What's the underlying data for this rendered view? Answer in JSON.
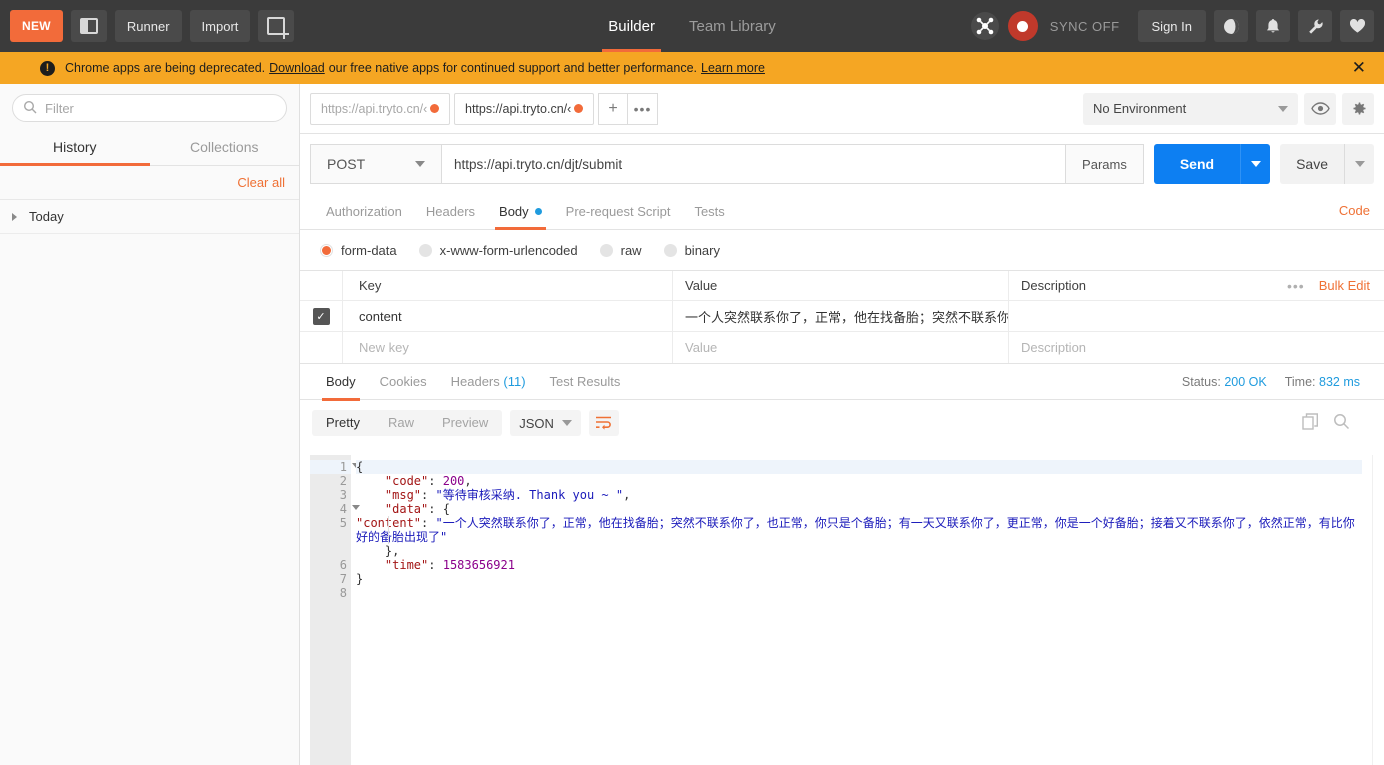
{
  "topbar": {
    "new_label": "NEW",
    "sidebar_toggle": "sidebar-toggle",
    "runner_label": "Runner",
    "import_label": "Import",
    "new_tab_label": "new-tab",
    "tabs": [
      {
        "label": "Builder",
        "active": true
      },
      {
        "label": "Team Library",
        "active": false
      }
    ],
    "sync_label": "SYNC OFF",
    "signin_label": "Sign In"
  },
  "banner": {
    "text_before": "Chrome apps are being deprecated.",
    "link1": "Download",
    "text_middle": "our free native apps for continued support and better performance.",
    "link2": "Learn more",
    "close": "✕",
    "bg_color": "#f5a623"
  },
  "sidebar": {
    "filter_placeholder": "Filter",
    "filter_value": "",
    "tabs": [
      {
        "label": "History",
        "active": true
      },
      {
        "label": "Collections",
        "active": false
      }
    ],
    "clear_all": "Clear all",
    "today_label": "Today"
  },
  "request_tabs": [
    {
      "url": "https://api.tryto.cn/‹",
      "active": false,
      "unsaved": true
    },
    {
      "url": "https://api.tryto.cn/‹",
      "active": true,
      "unsaved": true
    }
  ],
  "tabstrip": {
    "add": "+",
    "more": "•••"
  },
  "environment": {
    "selected": "No Environment",
    "eye_icon": "eye-icon",
    "gear_icon": "gear-icon"
  },
  "url_bar": {
    "method": "POST",
    "url": "https://api.tryto.cn/djt/submit",
    "params_label": "Params",
    "send_label": "Send",
    "save_label": "Save",
    "send_color": "#0d7ff2"
  },
  "request_tabs_row": {
    "tabs": [
      {
        "label": "Authorization",
        "active": false,
        "dot": false
      },
      {
        "label": "Headers",
        "active": false,
        "dot": false
      },
      {
        "label": "Body",
        "active": true,
        "dot": true
      },
      {
        "label": "Pre-request Script",
        "active": false,
        "dot": false
      },
      {
        "label": "Tests",
        "active": false,
        "dot": false
      }
    ],
    "code_link": "Code"
  },
  "body_modes": [
    {
      "label": "form-data",
      "selected": true
    },
    {
      "label": "x-www-form-urlencoded",
      "selected": false
    },
    {
      "label": "raw",
      "selected": false
    },
    {
      "label": "binary",
      "selected": false
    }
  ],
  "kv_table": {
    "headers": {
      "key": "Key",
      "value": "Value",
      "description": "Description"
    },
    "bulk_edit": "Bulk Edit",
    "more": "•••",
    "rows": [
      {
        "checked": true,
        "key": "content",
        "value": "一个人突然联系你了，正常，他在找备胎；突然不联系你了...",
        "description": ""
      }
    ],
    "empty_row": {
      "key": "New key",
      "value": "Value",
      "description": "Description"
    }
  },
  "response": {
    "tabs": [
      {
        "label": "Body",
        "active": true,
        "count": ""
      },
      {
        "label": "Cookies",
        "active": false,
        "count": ""
      },
      {
        "label": "Headers",
        "active": false,
        "count": "(11)"
      },
      {
        "label": "Test Results",
        "active": false,
        "count": ""
      }
    ],
    "status_label": "Status:",
    "status_value": "200 OK",
    "time_label": "Time:",
    "time_value": "832 ms",
    "view_modes": [
      {
        "label": "Pretty",
        "active": true
      },
      {
        "label": "Raw",
        "active": false
      },
      {
        "label": "Preview",
        "active": false
      }
    ],
    "format": "JSON",
    "wrap_icon": "word-wrap-icon",
    "copy_icon": "copy-icon",
    "search_icon": "search-icon",
    "body_lines": [
      {
        "n": 1,
        "fold": true,
        "highlight": true,
        "text": "{"
      },
      {
        "n": 2,
        "fold": false,
        "highlight": false,
        "text": "    \"code\": 200,"
      },
      {
        "n": 3,
        "fold": false,
        "highlight": false,
        "text": "    \"msg\": \"等待审核采纳. Thank you ~ \","
      },
      {
        "n": 4,
        "fold": true,
        "highlight": false,
        "text": "    \"data\": {"
      },
      {
        "n": 5,
        "fold": false,
        "highlight": false,
        "text": "        \"content\": \"一个人突然联系你了，正常，他在找备胎；突然不联系你了，也正常，你只是个备胎；有一天又联系你了，更正常，你是一个好备胎；接着又不联系你了，依然正常，有比你好的备胎出现了\""
      },
      {
        "n": 6,
        "fold": false,
        "highlight": false,
        "text": "    },"
      },
      {
        "n": 7,
        "fold": false,
        "highlight": false,
        "text": "    \"time\": 1583656921"
      },
      {
        "n": 8,
        "fold": false,
        "highlight": false,
        "text": "}"
      }
    ],
    "json": {
      "code": 200,
      "msg": "等待审核采纳. Thank you ~ ",
      "data_content": "一个人突然联系你了，正常，他在找备胎；突然不联系你了，也正常，你只是个备胎；有一天又联系你了，更正常，你是一个好备胎；接着又不联系你了，依然正常，有比你好的备胎出现了",
      "time": 1583656921
    }
  },
  "colors": {
    "accent": "#f26b3a",
    "blue": "#0d7ff2",
    "link_blue": "#1f9bde",
    "topbar": "#3b3b3b"
  }
}
